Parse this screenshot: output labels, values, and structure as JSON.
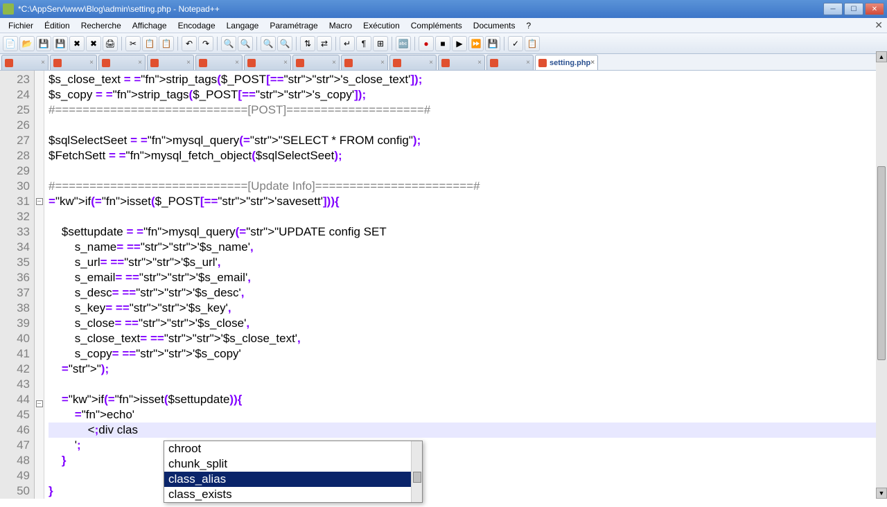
{
  "window": {
    "title": "*C:\\AppServ\\www\\Blog\\admin\\setting.php - Notepad++"
  },
  "menu": {
    "items": [
      "Fichier",
      "Édition",
      "Recherche",
      "Affichage",
      "Encodage",
      "Langage",
      "Paramétrage",
      "Macro",
      "Exécution",
      "Compléments",
      "Documents",
      "?"
    ]
  },
  "tabs": {
    "blank_count": 11,
    "active": {
      "label": "setting.php"
    }
  },
  "gutter": {
    "start": 23,
    "end": 50
  },
  "code": {
    "lines": [
      {
        "n": 23,
        "raw": "$s_close_text = strip_tags($_POST['s_close_text']);"
      },
      {
        "n": 24,
        "raw": "$s_copy = strip_tags($_POST['s_copy']);"
      },
      {
        "n": 25,
        "raw": "#============================[POST]====================#"
      },
      {
        "n": 26,
        "raw": ""
      },
      {
        "n": 27,
        "raw": "$sqlSelectSeet = mysql_query(\"SELECT * FROM config\");"
      },
      {
        "n": 28,
        "raw": "$FetchSett = mysql_fetch_object($sqlSelectSeet);"
      },
      {
        "n": 29,
        "raw": ""
      },
      {
        "n": 30,
        "raw": "#============================[Update Info]=======================#"
      },
      {
        "n": 31,
        "raw": "if(isset($_POST['savesett'])){"
      },
      {
        "n": 32,
        "raw": ""
      },
      {
        "n": 33,
        "raw": "    $settupdate = mysql_query(\"UPDATE config SET"
      },
      {
        "n": 34,
        "raw": "        s_name= '$s_name',"
      },
      {
        "n": 35,
        "raw": "        s_url= '$s_url',"
      },
      {
        "n": 36,
        "raw": "        s_email= '$s_email',"
      },
      {
        "n": 37,
        "raw": "        s_desc= '$s_desc',"
      },
      {
        "n": 38,
        "raw": "        s_key= '$s_key',"
      },
      {
        "n": 39,
        "raw": "        s_close= '$s_close',"
      },
      {
        "n": 40,
        "raw": "        s_close_text= '$s_close_text',"
      },
      {
        "n": 41,
        "raw": "        s_copy= '$s_copy'"
      },
      {
        "n": 42,
        "raw": "    \");"
      },
      {
        "n": 43,
        "raw": ""
      },
      {
        "n": 44,
        "raw": "    if(isset($settupdate)){"
      },
      {
        "n": 45,
        "raw": "        echo'"
      },
      {
        "n": 46,
        "raw": "            <div clas"
      },
      {
        "n": 47,
        "raw": "        ';"
      },
      {
        "n": 48,
        "raw": "    }"
      },
      {
        "n": 49,
        "raw": ""
      },
      {
        "n": 50,
        "raw": "}"
      }
    ]
  },
  "autocomplete": {
    "items": [
      "chroot",
      "chunk_split",
      "class_alias",
      "class_exists"
    ],
    "selected_index": 2
  }
}
